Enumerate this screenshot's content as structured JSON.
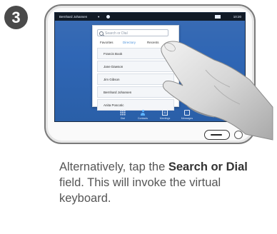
{
  "step_number": "3",
  "screen": {
    "topbar": {
      "user": "Bernhard Johansen",
      "time": "10:20"
    },
    "search": {
      "placeholder": "Search or Dial"
    },
    "tabs": [
      "Favorites",
      "Directory",
      "Recents"
    ],
    "contacts": [
      "Francis Book",
      "Jane Dawson",
      "Jim Gibson",
      "Bernhard Johansen",
      "Anita Poscotic"
    ],
    "nav": [
      {
        "label": "Dial",
        "icon": "keypad-icon"
      },
      {
        "label": "Contacts",
        "icon": "person-icon"
      },
      {
        "label": "Meetings",
        "icon": "calendar-icon"
      },
      {
        "label": "Messages",
        "icon": "message-icon"
      }
    ]
  },
  "caption": {
    "pre": "Alternatively, tap the ",
    "bold": "Search or Dial",
    "post": " field. This will invoke the virtual keyboard."
  }
}
